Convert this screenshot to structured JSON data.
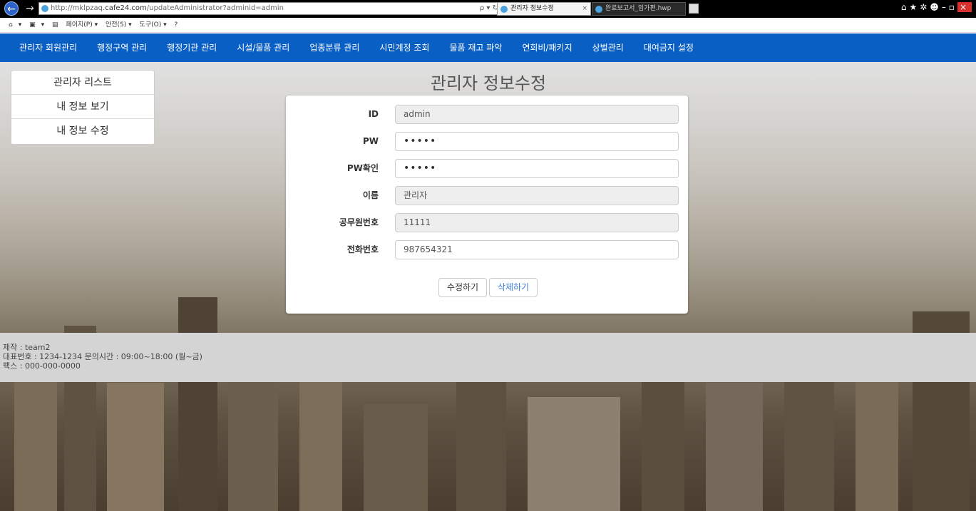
{
  "browser": {
    "url_prefix": "http://mklpzaq.",
    "url_domain": "cafe24.com",
    "url_path": "/updateAdministrator?adminid=admin",
    "search_controls": "ρ ▾ ↻",
    "active_tab": "관리자 정보수정",
    "inactive_tab": "완료보고서_임가편.hwp",
    "command_bar": [
      "▾",
      "▾",
      "페이지(P) ▾",
      "안전(S) ▾",
      "도구(O) ▾"
    ]
  },
  "nav": {
    "items": [
      "관리자 회원관리",
      "행정구역 관리",
      "행정기관 관리",
      "시설/물품 관리",
      "업종분류 관리",
      "시민계정 조회",
      "물품 재고 파악",
      "연회비/패키지",
      "상벌관리",
      "대여금지 설정"
    ]
  },
  "sidebar": {
    "items": [
      "관리자 리스트",
      "내 정보 보기",
      "내 정보 수정"
    ]
  },
  "page": {
    "title": "관리자 정보수정"
  },
  "form": {
    "fields": [
      {
        "label": "ID",
        "value": "admin"
      },
      {
        "label": "PW",
        "value": "•••••"
      },
      {
        "label": "PW확인",
        "value": "•••••"
      },
      {
        "label": "이름",
        "value": "관리자"
      },
      {
        "label": "공무원번호",
        "value": "11111"
      },
      {
        "label": "전화번호",
        "value": "987654321"
      }
    ],
    "edit_button": "수정하기",
    "delete_button": "삭제하기"
  },
  "footer": {
    "line1": "제작 : team2",
    "line2": "대표번호 : 1234-1234 문의시간 : 09:00~18:00 (월~금)",
    "line3": "팩스 : 000-000-0000"
  },
  "colors": {
    "nav_bg": "#0a5fc4",
    "footer_bg": "#d4d4d4"
  }
}
